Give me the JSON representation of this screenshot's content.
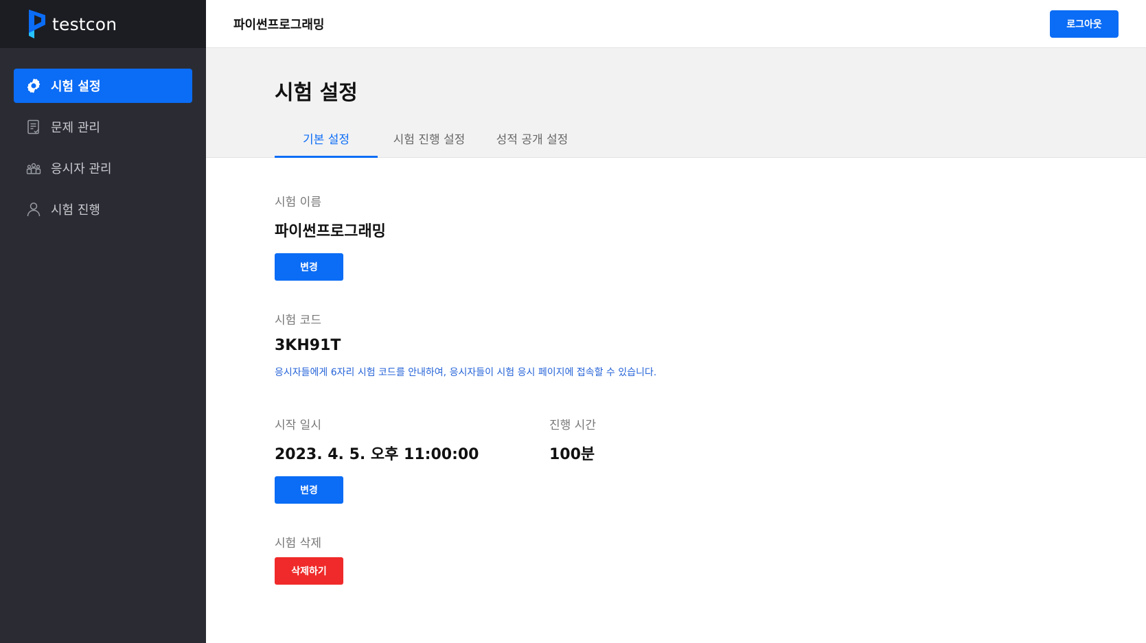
{
  "brand": {
    "name": "testcon",
    "accent": "#0b6cf5"
  },
  "sidebar": {
    "items": [
      {
        "label": "시험 설정",
        "icon": "gear-icon",
        "active": true
      },
      {
        "label": "문제 관리",
        "icon": "document-check-icon",
        "active": false
      },
      {
        "label": "응시자 관리",
        "icon": "group-icon",
        "active": false
      },
      {
        "label": "시험 진행",
        "icon": "person-icon",
        "active": false
      }
    ]
  },
  "topbar": {
    "title": "파이썬프로그래밍",
    "logout_label": "로그아웃"
  },
  "page": {
    "title": "시험 설정"
  },
  "tabs": [
    {
      "label": "기본 설정",
      "active": true
    },
    {
      "label": "시험 진행 설정",
      "active": false
    },
    {
      "label": "성적 공개 설정",
      "active": false
    }
  ],
  "exam_name": {
    "label": "시험 이름",
    "value": "파이썬프로그래밍",
    "button": "변경"
  },
  "exam_code": {
    "label": "시험 코드",
    "value": "3KH91T",
    "hint": "응시자들에게 6자리 시험 코드를 안내하여, 응시자들이 시험 응시 페이지에 접속할 수 있습니다."
  },
  "start_time": {
    "label": "시작 일시",
    "value": "2023. 4. 5. 오후 11:00:00",
    "button": "변경"
  },
  "duration": {
    "label": "진행 시간",
    "value": "100분"
  },
  "delete": {
    "label": "시험 삭제",
    "button": "삭제하기",
    "color": "#f02a2a"
  }
}
